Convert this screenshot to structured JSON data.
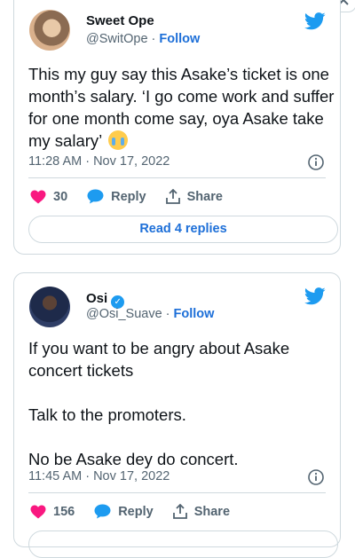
{
  "tweets": [
    {
      "name": "Sweet Ope",
      "handle": "@SwitOpe",
      "separator": "·",
      "follow_label": "Follow",
      "text": "This my guy say this Asake’s ticket is one month’s salary. ‘I go come work and suffer for one month come say, oya Asake take my salary’",
      "emoji": "loudly-crying-face",
      "timestamp": "11:28 AM · Nov 17, 2022",
      "likes": "30",
      "reply_label": "Reply",
      "share_label": "Share",
      "read_replies_label": "Read 4 replies"
    },
    {
      "name": "Osi",
      "verified": true,
      "handle": "@Osi_Suave",
      "separator": "·",
      "follow_label": "Follow",
      "text": "If you want to be angry about Asake concert tickets\n\nTalk to the promoters.\n\nNo be Asake dey do concert.",
      "timestamp": "11:45 AM · Nov 17, 2022",
      "likes": "156",
      "reply_label": "Reply",
      "share_label": "Share"
    }
  ],
  "icons": [
    "twitter-bird-icon",
    "info-icon",
    "heart-icon",
    "reply-bubble-icon",
    "share-icon",
    "close-icon",
    "verified-badge-icon"
  ],
  "colors": {
    "twitter_blue": "#1d9bf0",
    "link_blue": "#1d6fd8",
    "like_red": "#f91880",
    "secondary_text": "#536471",
    "border": "#cfd9de"
  }
}
